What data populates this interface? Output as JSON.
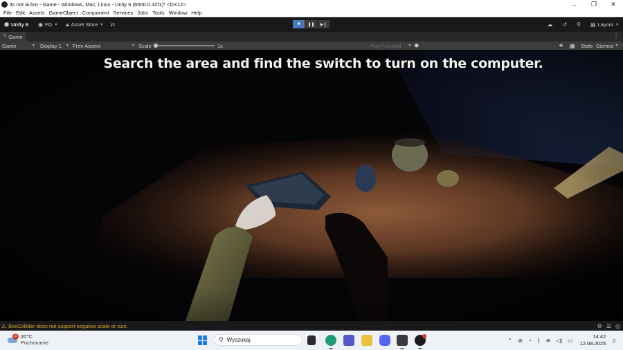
{
  "window": {
    "title": "its not ai bro - Game - Windows, Mac, Linux - Unity 6 (6000.0.32f1)* <DX12>",
    "minimize": "–",
    "maximize": "❐",
    "close": "✕"
  },
  "menu": [
    "File",
    "Edit",
    "Assets",
    "GameObject",
    "Component",
    "Services",
    "Jobs",
    "Tools",
    "Window",
    "Help"
  ],
  "toolbar": {
    "unity_label": "Unity 6",
    "account_label": "FG",
    "asset_store_label": "Asset Store",
    "layout_label": "Layout"
  },
  "tab": {
    "game_label": "Game"
  },
  "gamebar": {
    "view_mode": "Game",
    "display": "Display 1",
    "aspect": "Free Aspect",
    "scale_label": "Scale",
    "scale_value": "1x",
    "play_focused": "Play Focused",
    "stats": "Stats",
    "gizmos": "Gizmos"
  },
  "game": {
    "objective_text": "Search the area and find the switch to turn on the computer."
  },
  "console": {
    "warning_message": "BoxCollider does not support negative scale or size."
  },
  "taskbar": {
    "weather_temp": "20°C",
    "weather_desc": "Pochmurnie",
    "weather_badge": "2",
    "search_placeholder": "Wyszukaj",
    "time": "14:42",
    "date": "12.09.2025"
  },
  "colors": {
    "accent_play": "#4a7bbd",
    "warning": "#e9b01a",
    "editor_bg": "#191919",
    "taskbar_bg": "#eef1f6"
  }
}
